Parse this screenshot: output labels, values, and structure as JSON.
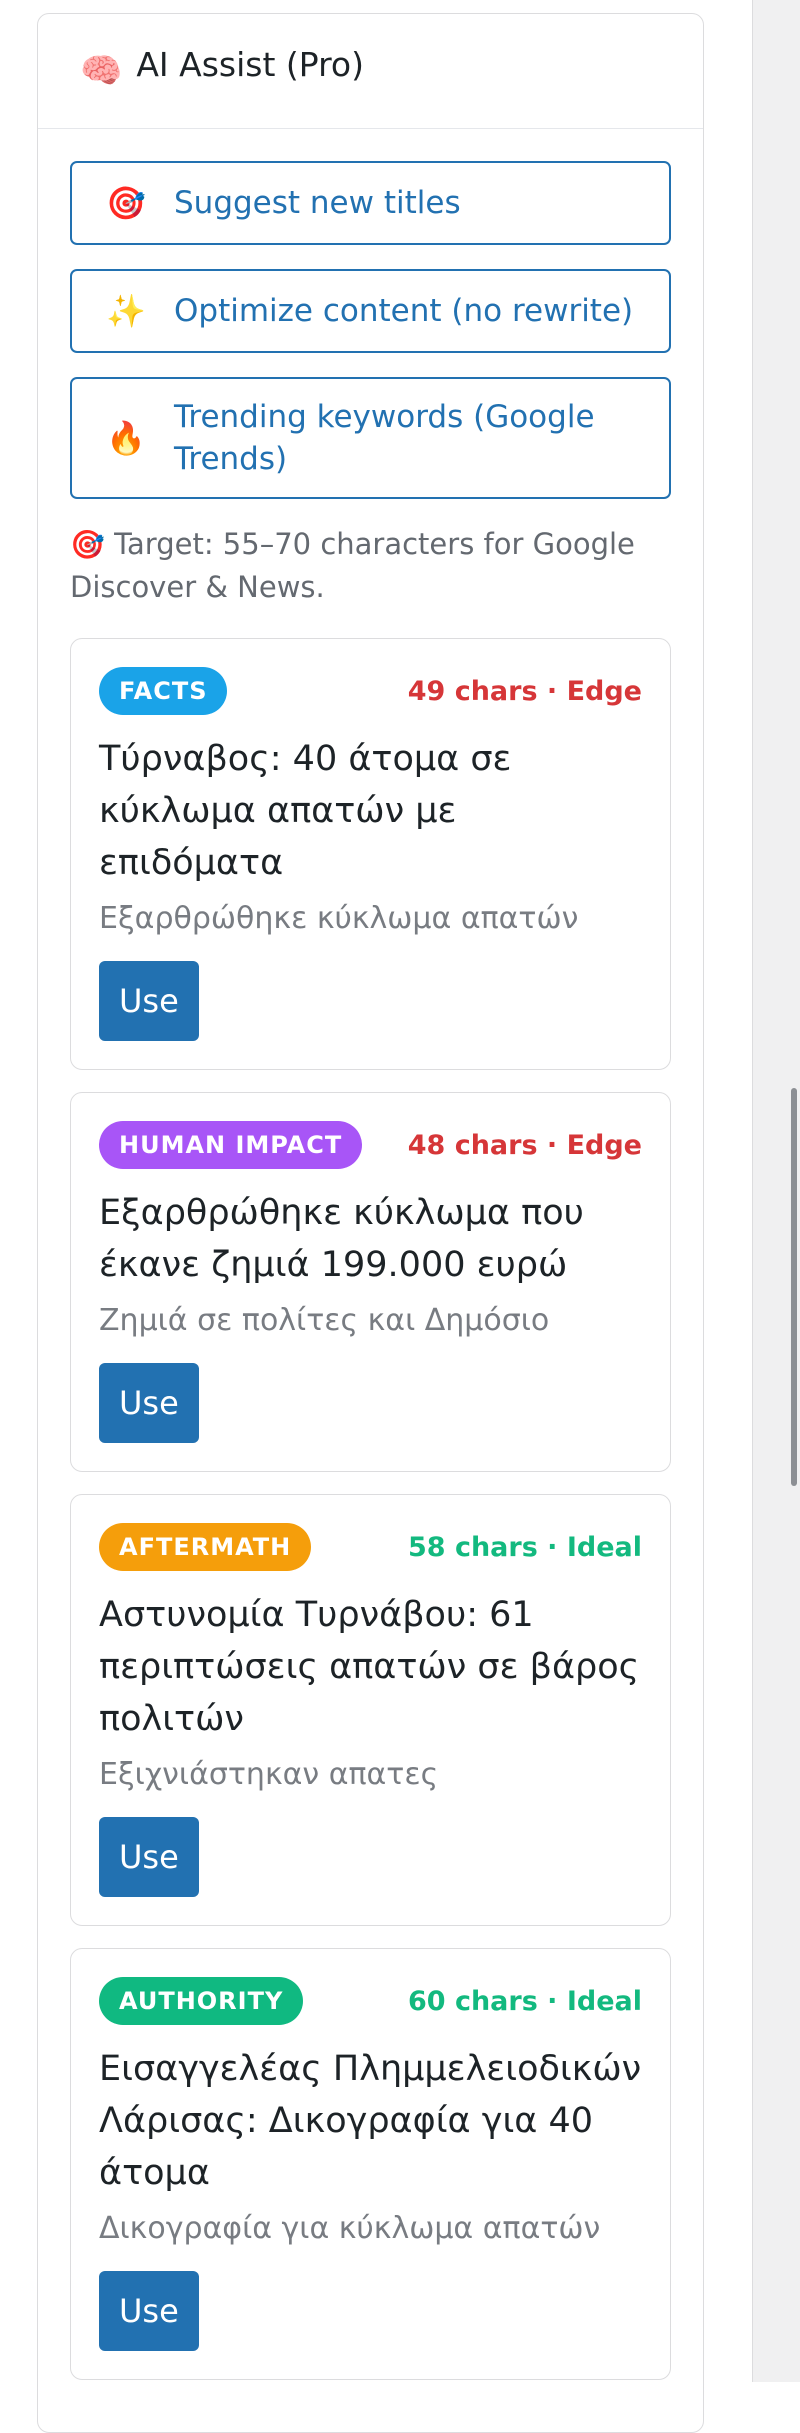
{
  "colors": {
    "accent": "#2271b1",
    "edge": "#d63638",
    "ideal": "#13b97f",
    "facts": "#1aa3e8",
    "human_impact": "#a855f7",
    "aftermath": "#f59e0b",
    "authority": "#10b981"
  },
  "panel": {
    "title_emoji": "🧠",
    "title": "AI Assist (Pro)"
  },
  "actions": [
    {
      "emoji": "🎯",
      "label": "Suggest new titles"
    },
    {
      "emoji": "✨",
      "label": "Optimize content (no rewrite)"
    },
    {
      "emoji": "🔥",
      "label": "Trending keywords (Google Trends)"
    }
  ],
  "hint": {
    "emoji": "🎯",
    "text": "Target: 55–70 characters for Google Discover & News."
  },
  "suggestions": [
    {
      "tag": "FACTS",
      "meta": "49 chars · Edge",
      "title": "Τύρναβος: 40 άτομα σε κύκλωμα απατών με επιδόματα",
      "subtitle": "Εξαρθρώθηκε κύκλωμα απατών",
      "use_label": "Use"
    },
    {
      "tag": "HUMAN IMPACT",
      "meta": "48 chars · Edge",
      "title": "Εξαρθρώθηκε κύκλωμα που έκανε ζημιά 199.000 ευρώ",
      "subtitle": "Ζημιά σε πολίτες και Δημόσιο",
      "use_label": "Use"
    },
    {
      "tag": "AFTERMATH",
      "meta": "58 chars · Ideal",
      "title": "Αστυνομία Τυρνάβου: 61 περιπτώσεις απατών σε βάρος πολιτών",
      "subtitle": "Εξιχνιάστηκαν απατες",
      "use_label": "Use"
    },
    {
      "tag": "AUTHORITY",
      "meta": "60 chars · Ideal",
      "title": "Εισαγγελέας Πλημμελειοδικών Λάρισας: Δικογραφία για 40 άτομα",
      "subtitle": "Δικογραφία για κύκλωμα απατών",
      "use_label": "Use"
    }
  ]
}
